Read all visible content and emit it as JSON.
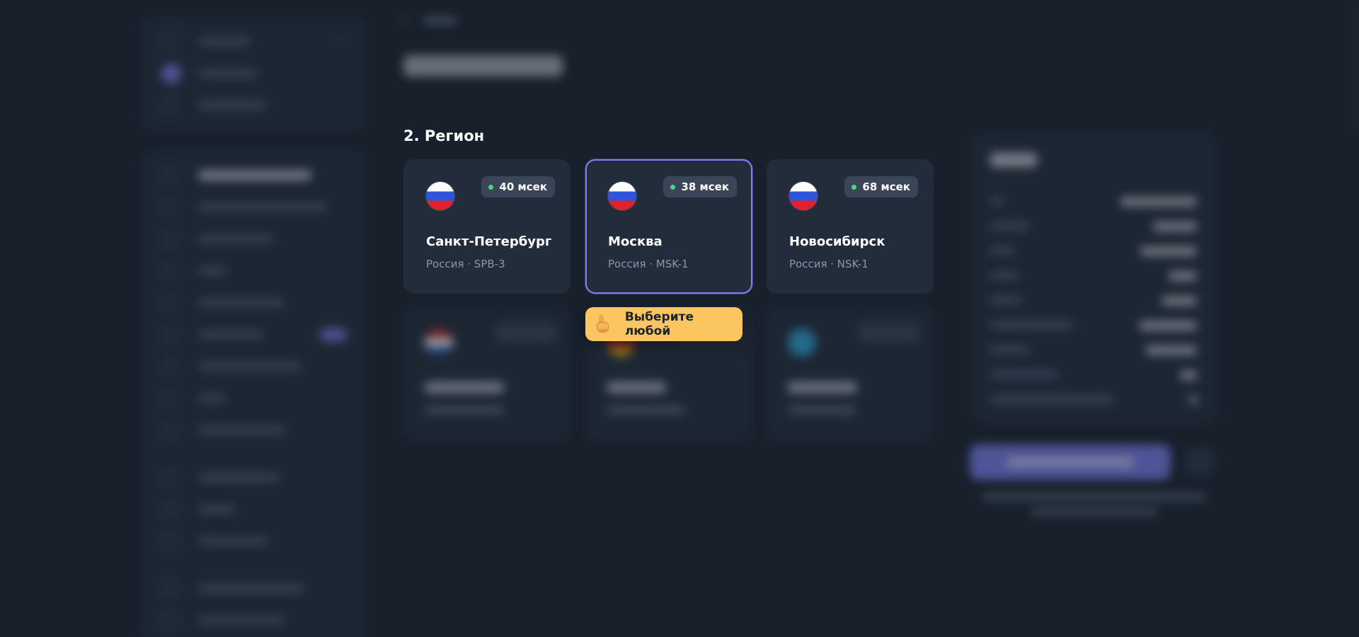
{
  "region_section": {
    "title": "2. Регион",
    "regions": [
      {
        "city": "Санкт-Петербург",
        "country_code": "Россия · SPB-3",
        "ping": "40 мсек",
        "selected": false
      },
      {
        "city": "Москва",
        "country_code": "Россия · MSK-1",
        "ping": "38 мсек",
        "selected": true
      },
      {
        "city": "Новосибирск",
        "country_code": "Россия · NSK-1",
        "ping": "68 мсек",
        "selected": false
      }
    ]
  },
  "tooltip": {
    "text": "Выберите любой",
    "icon": "pointing-hand-icon"
  },
  "colors": {
    "background": "#17202b",
    "card": "#222c3a",
    "accent": "#7b7ff0",
    "ping_ok": "#4cd784",
    "tooltip_bg": "#fbc660",
    "muted_text": "#8c96a8"
  },
  "icons": {
    "flag": "russia-flag-icon",
    "ping": "status-dot-icon",
    "breadcrumb": "chevron-left-icon"
  }
}
